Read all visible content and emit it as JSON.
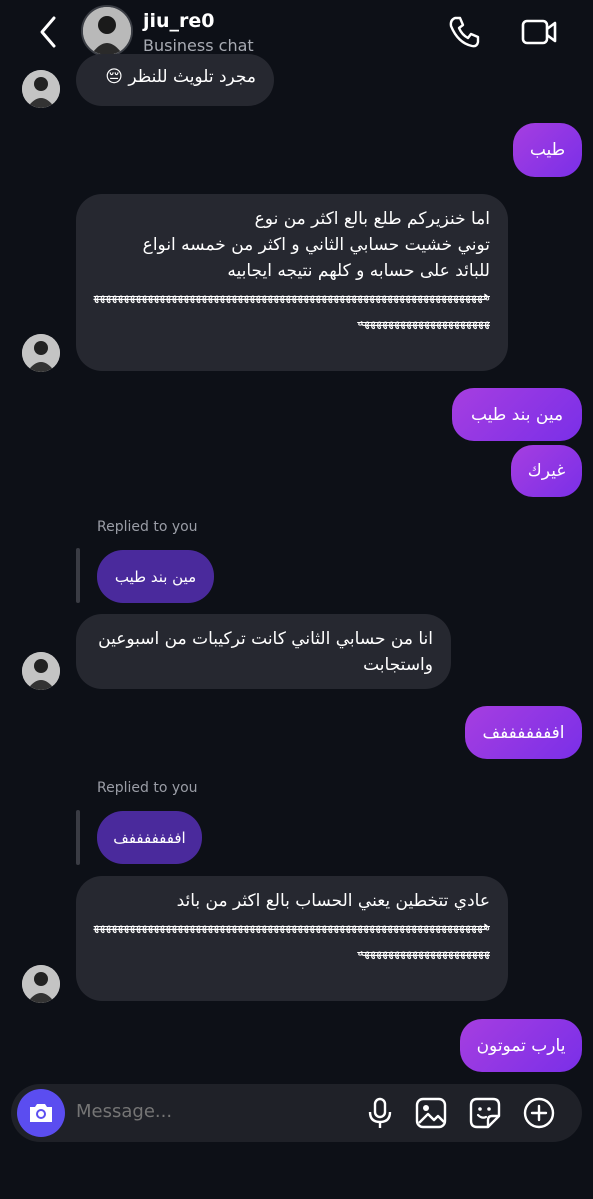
{
  "header": {
    "username": "jiu_re0",
    "subtitle": "Business chat",
    "icons": [
      "back-chevron-icon",
      "phone-icon",
      "video-camera-icon"
    ]
  },
  "messages": {
    "m1": "مجرد تلويث للنظر 😔",
    "m2": "طيب",
    "m3_line1": "اما خنزيركم طلع بالع  اكثر من نوع",
    "m3_line2": "توني خشيت حسابي الثاني و اكثر من خمسه انواع",
    "m3_line3": "للبائد على حسابه و كلهم  نتيجه ايجابيه",
    "m3_strike": "هههههههههههههههههههههههههههههههههههههههههههههههههههههههههههههههههههههههههههههههههههههههه",
    "m4": "مين بند طيب",
    "m5": "غيرك",
    "reply1_label": "Replied to you",
    "reply1_quote": "مين بند طيب",
    "m6_line1": "انا من حسابي الثاني كانت تركيبات من اسبوعين",
    "m6_line2": "واستجابت",
    "m7": "افففففففف",
    "reply2_label": "Replied to you",
    "reply2_quote": "افففففففف",
    "m8_line1": "عادي تتخطين يعني الحساب بالع  اكثر من بائد",
    "m8_strike": "هههههههههههههههههههههههههههههههههههههههههههههههههههههههههههههههههههههههههههههههههههههههه",
    "m9": "يارب تموتون"
  },
  "composer": {
    "placeholder": "Message...",
    "icons": [
      "camera-icon",
      "microphone-icon",
      "gallery-icon",
      "sticker-icon",
      "add-icon"
    ]
  },
  "colors": {
    "background": "#0d1017",
    "incoming_bubble": "#262830",
    "outgoing_bubble": "#9a38e4",
    "reply_bubble": "#4a2a9c",
    "camera_button": "#5b4df0"
  }
}
